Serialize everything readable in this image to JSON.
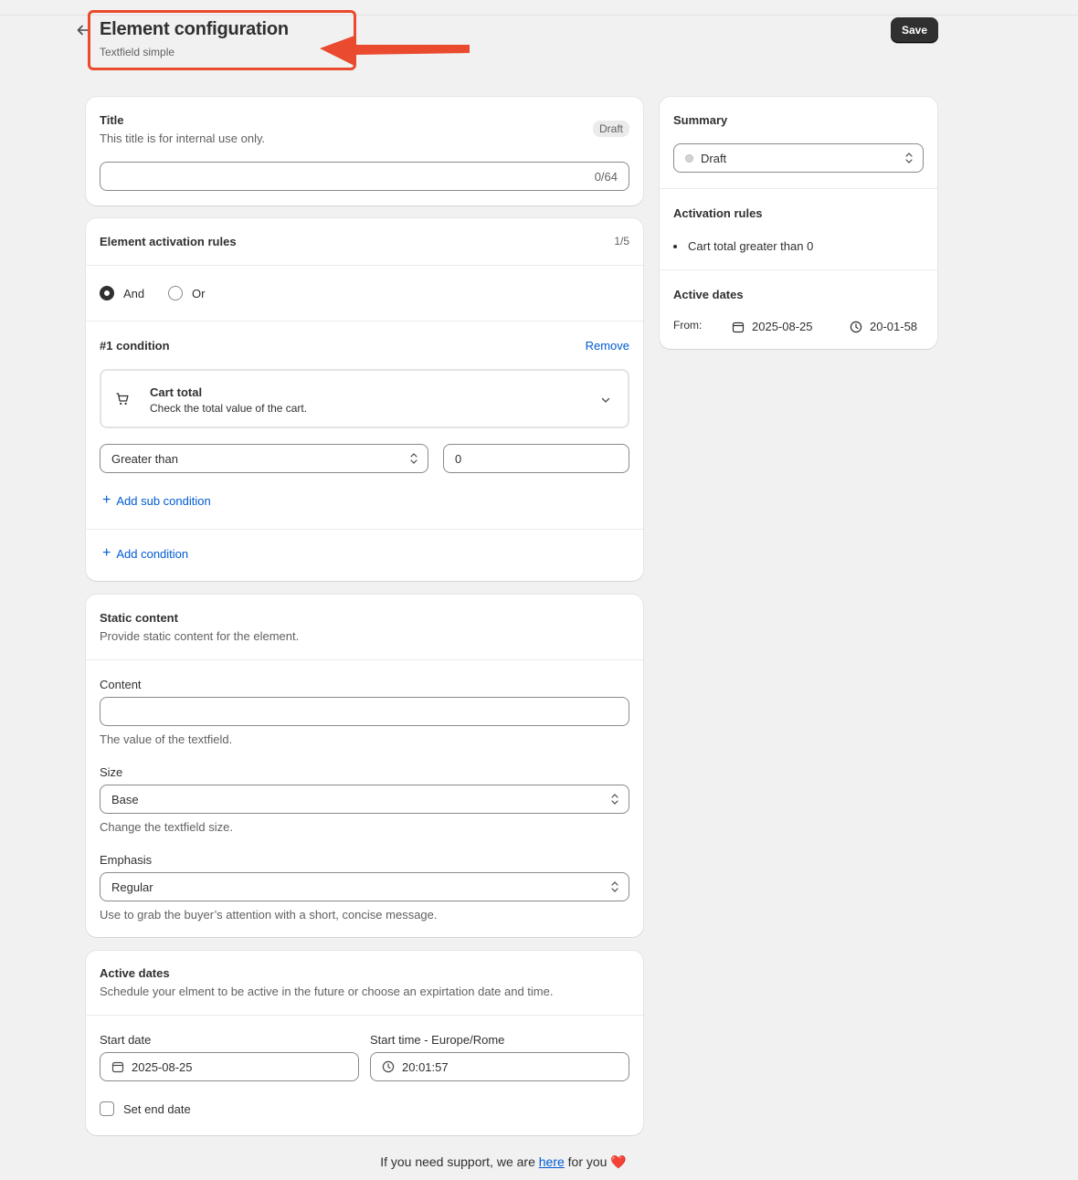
{
  "header": {
    "title": "Element configuration",
    "subtitle": "Textfield simple",
    "save_label": "Save"
  },
  "title_card": {
    "heading": "Title",
    "helper": "This title is for internal use only.",
    "badge": "Draft",
    "value": "",
    "counter": "0/64"
  },
  "rules_card": {
    "heading": "Element activation rules",
    "count": "1/5",
    "logic_options": [
      "And",
      "Or"
    ],
    "selected_logic": "And",
    "condition_title": "#1 condition",
    "remove_label": "Remove",
    "condition_name": "Cart total",
    "condition_desc": "Check the total value of the cart.",
    "operator": "Greater than",
    "operand": "0",
    "add_sub_label": "Add sub condition",
    "add_condition_label": "Add condition"
  },
  "static_card": {
    "heading": "Static content",
    "helper": "Provide static content for the element.",
    "content_label": "Content",
    "content_value": "",
    "content_help": "The value of the textfield.",
    "size_label": "Size",
    "size_value": "Base",
    "size_help": "Change the textfield size.",
    "emphasis_label": "Emphasis",
    "emphasis_value": "Regular",
    "emphasis_help": "Use to grab the buyer’s attention with a short, concise message."
  },
  "dates_card": {
    "heading": "Active dates",
    "helper": "Schedule your elment to be active in the future or choose an expirtation date and time.",
    "start_date_label": "Start date",
    "start_date": "2025-08-25",
    "start_time_label": "Start time - Europe/Rome",
    "start_time": "20:01:57",
    "end_date_label": "Set end date",
    "end_date_checked": false
  },
  "summary": {
    "heading": "Summary",
    "status": "Draft",
    "rules_heading": "Activation rules",
    "rules": [
      "Cart total greater than 0"
    ],
    "dates_heading": "Active dates",
    "from_label": "From:",
    "from_date": "2025-08-25",
    "from_time": "20-01-58"
  },
  "footer": {
    "before": "If you need support, we are ",
    "link": "here",
    "after": " for you",
    "heart": "❤️"
  },
  "colors": {
    "accent_red": "#ea4a2e",
    "link": "#005bd3",
    "save_bg": "#303030"
  }
}
